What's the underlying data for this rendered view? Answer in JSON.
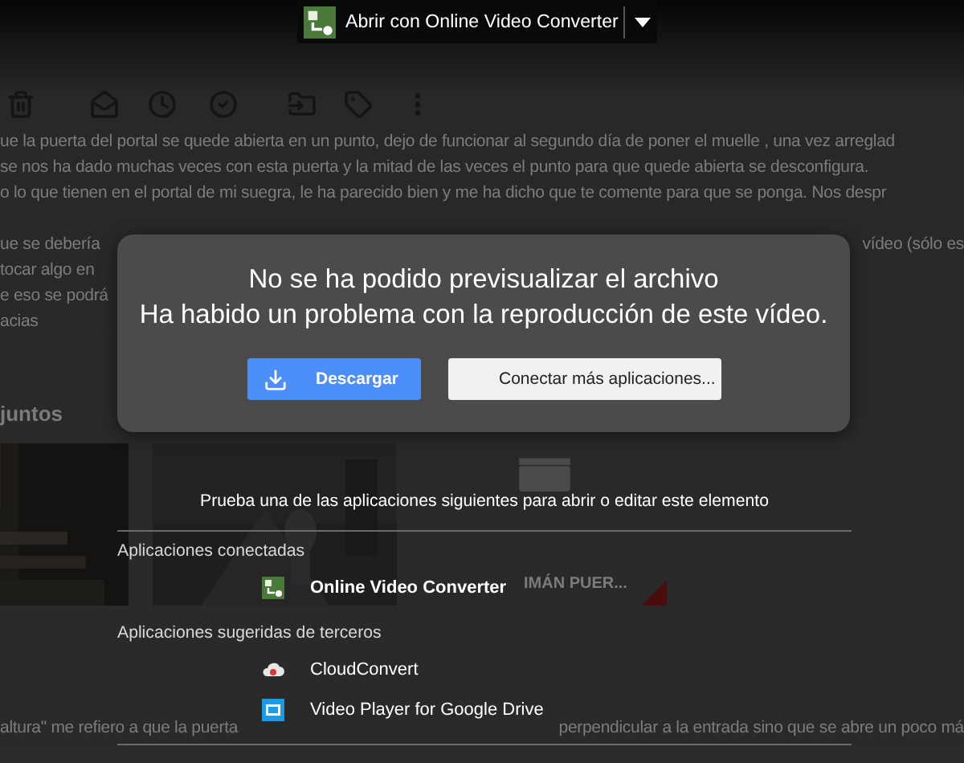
{
  "top_bar": {
    "label": "Abrir con Online Video Converter"
  },
  "message": {
    "lines": [
      {
        "segments": [
          "ue la puerta del portal se quede abierta en un punto, dejo de funcionar al segundo día de poner el muelle , una vez arreglad"
        ]
      },
      {
        "segments": [
          "se nos ha dado muchas veces con esta puerta y la mitad de las veces el punto para que quede abierta se desconfigura."
        ]
      },
      {
        "segments": [
          "o lo que tienen en el portal de mi suegra, le ha parecido bien y me ha dicho que te comente para que se ponga. Nos despr"
        ]
      },
      {
        "segments": [
          "ue se debería",
          "vídeo (sólo es"
        ]
      },
      {
        "segments": [
          "tocar algo en"
        ]
      },
      {
        "segments": [
          "e eso se podrá"
        ]
      },
      {
        "segments": [
          "acias"
        ]
      }
    ],
    "attachments_heading": "juntos",
    "attachments": [
      {
        "kind": "picture"
      },
      {
        "kind": "picture"
      },
      {
        "kind": "file",
        "title": "IMÁN PUER..."
      }
    ],
    "footer_segments": [
      "altura\" me refiero a que la puerta",
      "perpendicular a la entrada sino que se abre un poco má"
    ]
  },
  "dialog": {
    "title": "No se ha podido previsualizar el archivo",
    "subtitle": "Ha habido un problema con la reproducción de este vídeo.",
    "buttons": [
      {
        "kind": "primary",
        "label": "Descargar"
      },
      {
        "kind": "secondary",
        "label": "Conectar más aplicaciones..."
      }
    ]
  },
  "apps_panel": {
    "prompt": "Prueba una de las aplicaciones siguientes para abrir o editar este elemento",
    "sections": [
      {
        "heading": "Aplicaciones conectadas",
        "apps": [
          {
            "name": "Online Video Converter",
            "kind": "converter",
            "connected": true
          }
        ]
      },
      {
        "heading": "Aplicaciones sugeridas de terceros",
        "apps": [
          {
            "name": "CloudConvert",
            "kind": "cloud",
            "connected": false
          },
          {
            "name": "Video Player for Google Drive",
            "kind": "player",
            "connected": false
          }
        ]
      }
    ]
  }
}
